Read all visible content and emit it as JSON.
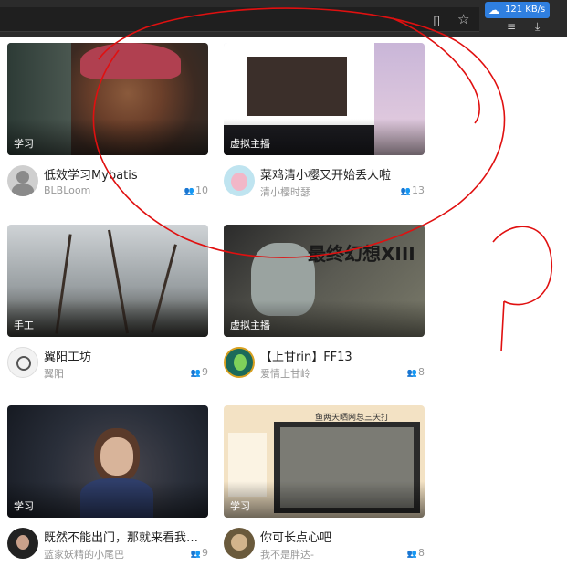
{
  "browser": {
    "download_speed": "121 KB/s",
    "icons": [
      "reader-mode-icon",
      "star-icon",
      "cloud-icon",
      "download-icon"
    ]
  },
  "cards": [
    {
      "tag": "学习",
      "title": "低效学习Mybatis",
      "author": "BLBLoom",
      "viewers": "10"
    },
    {
      "tag": "虚拟主播",
      "title": "菜鸡清小樱又开始丢人啦",
      "author": "清小樱时瑟",
      "viewers": "13"
    },
    {
      "tag": "手工",
      "title": "翼阳工坊",
      "author": "翼阳",
      "viewers": "9"
    },
    {
      "tag": "虚拟主播",
      "title": "【上甘rin】FF13",
      "author": "爱情上甘岭",
      "viewers": "8",
      "thumb_text": "最终幻想XIII"
    },
    {
      "tag": "学习",
      "title": "既然不能出门，那就来看我…",
      "author": "蓝家妖精的小尾巴",
      "viewers": "9"
    },
    {
      "tag": "学习",
      "title": "你可长点心吧",
      "author": "我不是胖达-",
      "viewers": "8",
      "thumb_text": "鱼两天晒网总三天打"
    }
  ],
  "colors": {
    "annotation": "#e01010",
    "speed_badge": "#2f7fe0"
  }
}
